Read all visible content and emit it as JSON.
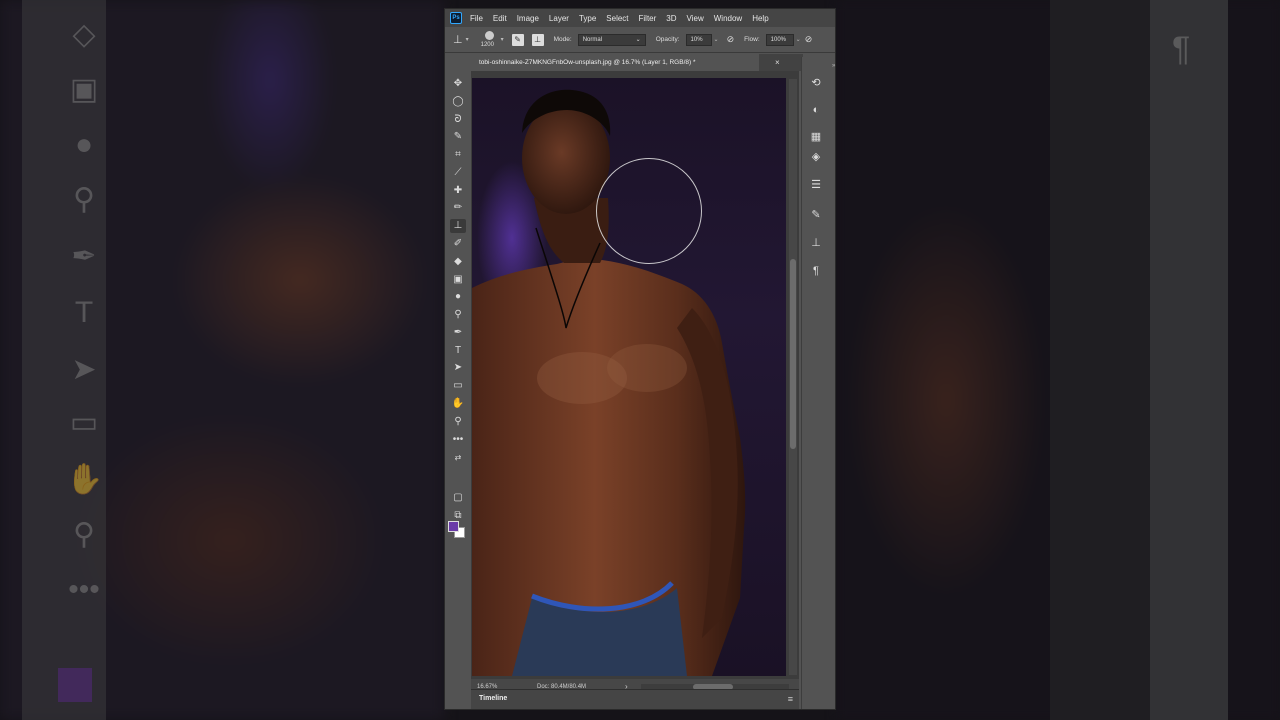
{
  "menu": [
    "File",
    "Edit",
    "Image",
    "Layer",
    "Type",
    "Select",
    "Filter",
    "3D",
    "View",
    "Window",
    "Help"
  ],
  "app_logo": "Ps",
  "options": {
    "tool_icon": "clone-stamp-icon",
    "brush_size": "1200",
    "mode_label": "Mode:",
    "mode_value": "Normal",
    "opacity_label": "Opacity:",
    "opacity_value": "10%",
    "flow_label": "Flow:",
    "flow_value": "100%"
  },
  "document": {
    "tab_title": "tobi-oshinnaike-Z7MKNGFnbOw-unsplash.jpg @ 16.7% (Layer 1, RGB/8) *",
    "close_label": "×"
  },
  "status": {
    "zoom": "16.67%",
    "doc_size": "Doc: 80.4M/80.4M",
    "arrow": "›"
  },
  "timeline": {
    "label": "Timeline",
    "menu_icon": "≡"
  },
  "colors": {
    "foreground": "#6a3aa8",
    "background": "#ffffff",
    "app_bg": "#535353"
  },
  "tools": [
    "move-icon",
    "marquee-icon",
    "lasso-icon",
    "quick-select-icon",
    "crop-icon",
    "eyedropper-icon",
    "healing-icon",
    "brush-icon",
    "clone-stamp-icon",
    "history-brush-icon",
    "eraser-icon",
    "gradient-icon",
    "blur-icon",
    "dodge-icon",
    "pen-icon",
    "type-icon",
    "path-select-icon",
    "rectangle-icon",
    "hand-icon",
    "zoom-icon",
    "more-tools-icon"
  ],
  "panels": [
    "history-panel-icon",
    "adjustments-panel-icon",
    "channels-panel-icon",
    "layers-panel-icon",
    "properties-panel-icon",
    "brush-settings-panel-icon",
    "clone-source-panel-icon",
    "paragraph-panel-icon"
  ]
}
